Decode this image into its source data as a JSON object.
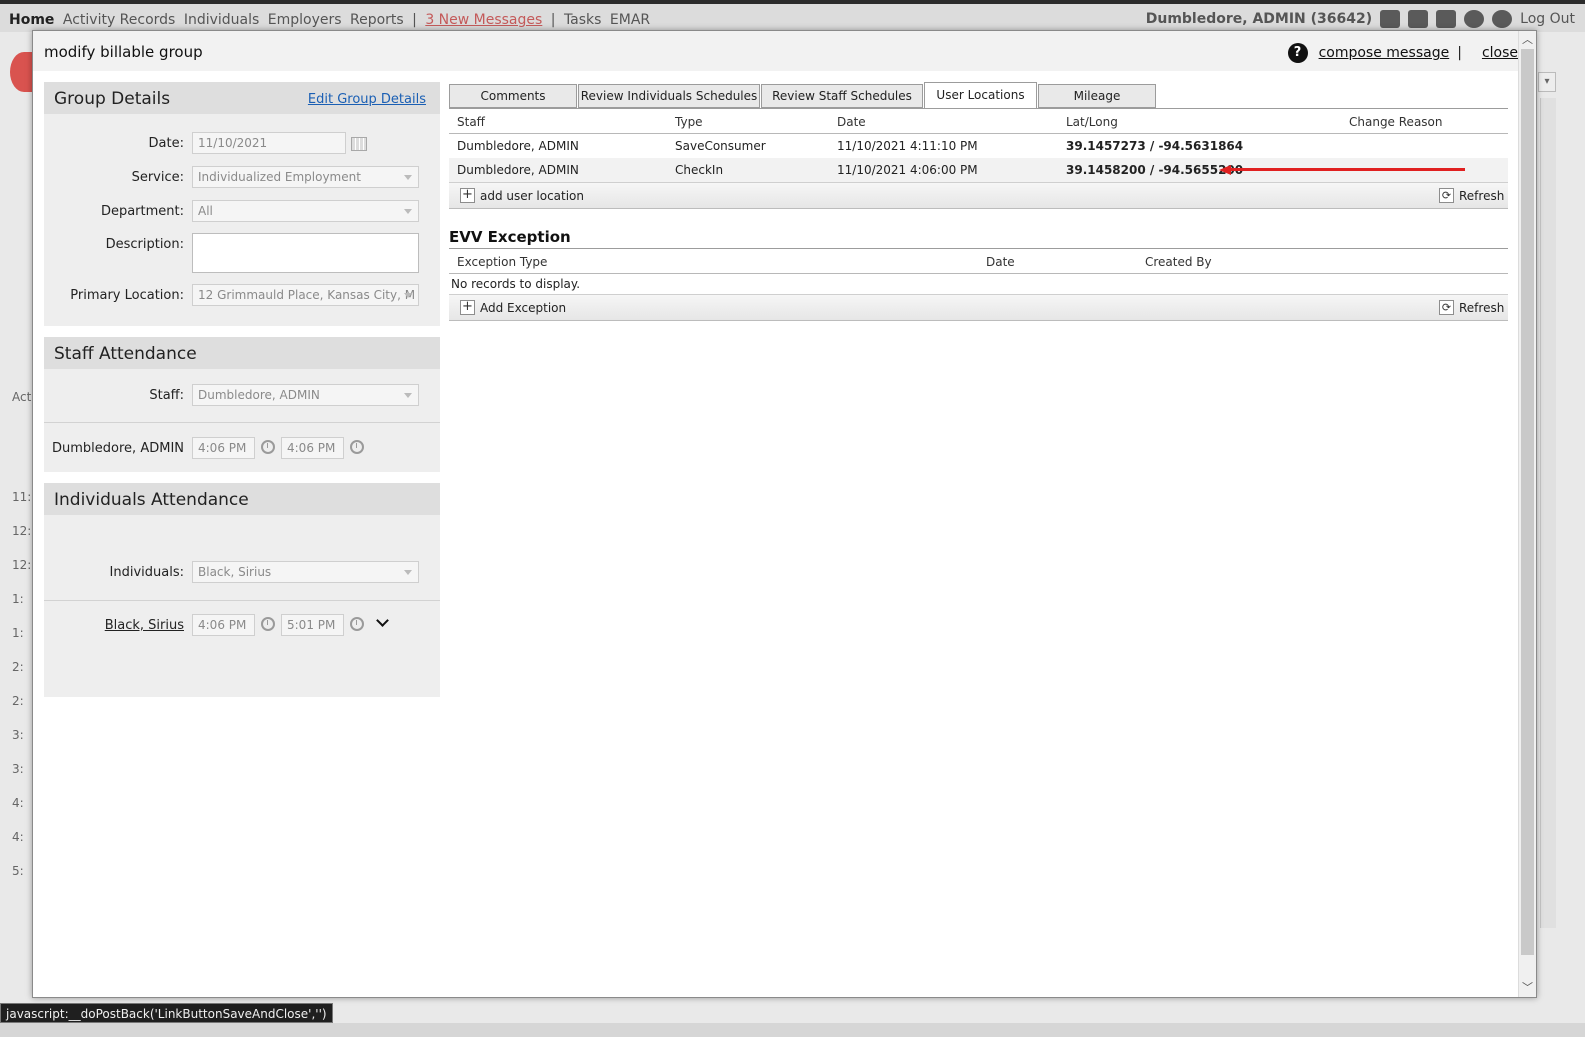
{
  "topnav": {
    "links": [
      "Home",
      "Activity Records",
      "Individuals",
      "Employers",
      "Reports"
    ],
    "messages": "3 New Messages",
    "sep": "|",
    "extra_links": [
      "Tasks",
      "EMAR"
    ],
    "user": "Dumbledore, ADMIN (36642)",
    "logout": "Log Out",
    "icons": [
      "home-icon",
      "users-icon",
      "archive-icon",
      "help-icon",
      "gear-icon"
    ]
  },
  "background": {
    "row_labels": [
      "11:",
      "12:",
      "12:",
      "1:",
      "1:",
      "2:",
      "2:",
      "3:",
      "3:",
      "4:",
      "4:",
      "5:"
    ],
    "act_label": "Act"
  },
  "modal": {
    "title": "modify billable group",
    "help_glyph": "?",
    "compose": "compose message",
    "separator": "|",
    "close": "close"
  },
  "group_details": {
    "title": "Group Details",
    "edit_link": "Edit Group Details",
    "date_label": "Date:",
    "date_value": "11/10/2021",
    "service_label": "Service:",
    "service_value": "Individualized Employment",
    "department_label": "Department:",
    "department_value": "All",
    "description_label": "Description:",
    "primary_location_label": "Primary Location:",
    "primary_location_value": "12 Grimmauld Place, Kansas City, M"
  },
  "staff_attendance": {
    "title": "Staff Attendance",
    "staff_label": "Staff:",
    "staff_value": "Dumbledore, ADMIN",
    "row_name": "Dumbledore, ADMIN",
    "start_time": "4:06 PM",
    "end_time": "4:06 PM"
  },
  "individuals_attendance": {
    "title": "Individuals Attendance",
    "individuals_label": "Individuals:",
    "individuals_value": "Black, Sirius",
    "row_name": "Black, Sirius",
    "start_time": "4:06 PM",
    "end_time": "5:01 PM"
  },
  "tabs": [
    {
      "label": "Comments",
      "active": false
    },
    {
      "label": "Review Individuals Schedules",
      "active": false
    },
    {
      "label": "Review Staff Schedules",
      "active": false
    },
    {
      "label": "User Locations",
      "active": true
    },
    {
      "label": "Mileage",
      "active": false
    }
  ],
  "user_locations": {
    "columns": [
      "Staff",
      "Type",
      "Date",
      "Lat/Long",
      "Change Reason"
    ],
    "rows": [
      {
        "staff": "Dumbledore, ADMIN",
        "type": "SaveConsumer",
        "date": "11/10/2021 4:11:10 PM",
        "latlong": "39.1457273 / -94.5631864",
        "reason": ""
      },
      {
        "staff": "Dumbledore, ADMIN",
        "type": "CheckIn",
        "date": "11/10/2021 4:06:00 PM",
        "latlong": "39.1458200 / -94.5655200",
        "reason": ""
      }
    ],
    "add_label": "add user location",
    "refresh_label": "Refresh"
  },
  "evv_exception": {
    "title": "EVV Exception",
    "columns": [
      "Exception Type",
      "Date",
      "Created By"
    ],
    "empty": "No records to display.",
    "add_label": "Add Exception",
    "refresh_label": "Refresh"
  },
  "statusbar": {
    "text": "javascript:__doPostBack('LinkButtonSaveAndClose','')"
  },
  "colors": {
    "link": "#1a5fb4",
    "annotation_arrow": "#e02020",
    "messages": "#c45a5a"
  }
}
